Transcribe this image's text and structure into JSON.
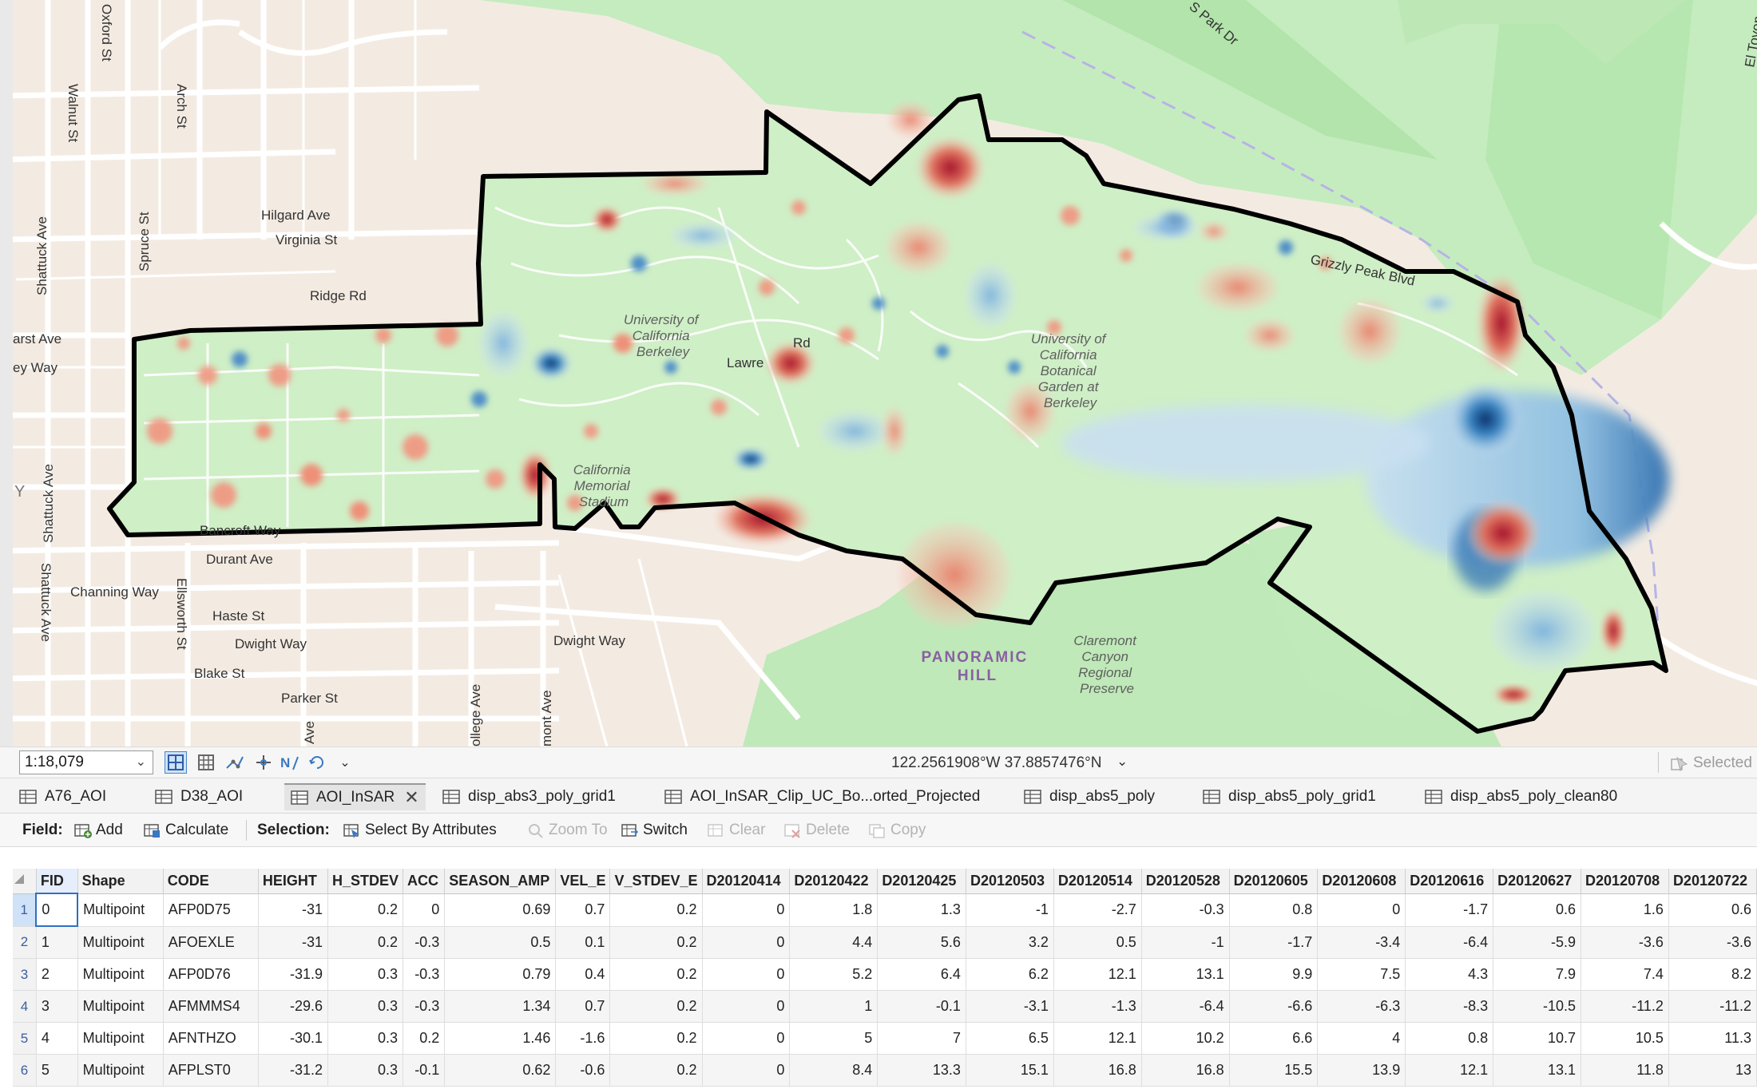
{
  "map": {
    "street_labels": [
      "Oxford St",
      "Walnut St",
      "Arch St",
      "Shattuck Ave",
      "Spruce St",
      "Hilgard Ave",
      "Virginia St",
      "Ridge Rd",
      "arst Ave",
      "ey Way",
      "Shattuck Ave",
      "Shattuck Ave",
      "Durant Ave",
      "Channing Way",
      "Ellsworth St",
      "Haste St",
      "Dwight Way",
      "Blake St",
      "Parker St",
      "Ave",
      "ollege Ave",
      "mont Ave",
      "Dwight Way",
      "Bancroft Way",
      "Lawre",
      "Rd",
      "S Park Dr",
      "Grizzly Peak Blvd",
      "El Toyon",
      "Y"
    ],
    "place_labels": {
      "ucb": [
        "University of",
        "California",
        "Berkeley"
      ],
      "botanical": [
        "University of",
        "California",
        "Botanical",
        "Garden at",
        "Berkeley"
      ],
      "stadium": [
        "California",
        "Memorial",
        "Stadium"
      ],
      "claremont": [
        "Claremont",
        "Canyon",
        "Regional",
        "Preserve"
      ],
      "panoramic": [
        "PANORAMIC",
        "HILL"
      ]
    },
    "colors": {
      "park": "#c5ecbf",
      "ground": "#f3ebe2",
      "boundary": "#000000",
      "blue_anomaly": "#2c6cb0",
      "red_anomaly": "#b2182b"
    }
  },
  "statusbar": {
    "scale": "1:18,079",
    "coordinates": "122.2561908°W 37.8857476°N",
    "selected": "Selected"
  },
  "tabs": [
    {
      "label": "A76_AOI",
      "active": false
    },
    {
      "label": "D38_AOI",
      "active": false
    },
    {
      "label": "AOI_InSAR",
      "active": true
    },
    {
      "label": "disp_abs3_poly_grid1",
      "active": false
    },
    {
      "label": "AOI_InSAR_Clip_UC_Bo...orted_Projected",
      "active": false
    },
    {
      "label": "disp_abs5_poly",
      "active": false
    },
    {
      "label": "disp_abs5_poly_grid1",
      "active": false
    },
    {
      "label": "disp_abs5_poly_clean80",
      "active": false
    }
  ],
  "toolbar": {
    "field_label": "Field:",
    "add": "Add",
    "calculate": "Calculate",
    "selection_label": "Selection:",
    "select_by_attributes": "Select By Attributes",
    "zoom_to": "Zoom To",
    "switch": "Switch",
    "clear": "Clear",
    "delete": "Delete",
    "copy": "Copy"
  },
  "table": {
    "columns": [
      "FID",
      "Shape",
      "CODE",
      "HEIGHT",
      "H_STDEV",
      "ACC",
      "SEASON_AMP",
      "VEL_E",
      "V_STDEV_E",
      "D20120414",
      "D20120422",
      "D20120425",
      "D20120503",
      "D20120514",
      "D20120528",
      "D20120605",
      "D20120608",
      "D20120616",
      "D20120627",
      "D20120708",
      "D20120722"
    ],
    "rows": [
      {
        "n": "1",
        "cells": [
          "0",
          "Multipoint",
          "AFP0D75",
          "-31",
          "0.2",
          "0",
          "0.69",
          "0.7",
          "0.2",
          "0",
          "1.8",
          "1.3",
          "-1",
          "-2.7",
          "-0.3",
          "0.8",
          "0",
          "-1.7",
          "0.6",
          "1.6",
          "0.6"
        ]
      },
      {
        "n": "2",
        "cells": [
          "1",
          "Multipoint",
          "AFOEXLE",
          "-31",
          "0.2",
          "-0.3",
          "0.5",
          "0.1",
          "0.2",
          "0",
          "4.4",
          "5.6",
          "3.2",
          "0.5",
          "-1",
          "-1.7",
          "-3.4",
          "-6.4",
          "-5.9",
          "-3.6",
          "-3.6"
        ]
      },
      {
        "n": "3",
        "cells": [
          "2",
          "Multipoint",
          "AFP0D76",
          "-31.9",
          "0.3",
          "-0.3",
          "0.79",
          "0.4",
          "0.2",
          "0",
          "5.2",
          "6.4",
          "6.2",
          "12.1",
          "13.1",
          "9.9",
          "7.5",
          "4.3",
          "7.9",
          "7.4",
          "8.2"
        ]
      },
      {
        "n": "4",
        "cells": [
          "3",
          "Multipoint",
          "AFMMMS4",
          "-29.6",
          "0.3",
          "-0.3",
          "1.34",
          "0.7",
          "0.2",
          "0",
          "1",
          "-0.1",
          "-3.1",
          "-1.3",
          "-6.4",
          "-6.6",
          "-6.3",
          "-8.3",
          "-10.5",
          "-11.2",
          "-11.2"
        ]
      },
      {
        "n": "5",
        "cells": [
          "4",
          "Multipoint",
          "AFNTHZO",
          "-30.1",
          "0.3",
          "0.2",
          "1.46",
          "-1.6",
          "0.2",
          "0",
          "5",
          "7",
          "6.5",
          "12.1",
          "10.2",
          "6.6",
          "4",
          "0.8",
          "10.7",
          "10.5",
          "11.3"
        ]
      },
      {
        "n": "6",
        "cells": [
          "5",
          "Multipoint",
          "AFPLST0",
          "-31.2",
          "0.3",
          "-0.1",
          "0.62",
          "-0.6",
          "0.2",
          "0",
          "8.4",
          "13.3",
          "15.1",
          "16.8",
          "16.8",
          "15.5",
          "13.9",
          "12.1",
          "13.1",
          "11.8",
          "13"
        ]
      }
    ]
  }
}
